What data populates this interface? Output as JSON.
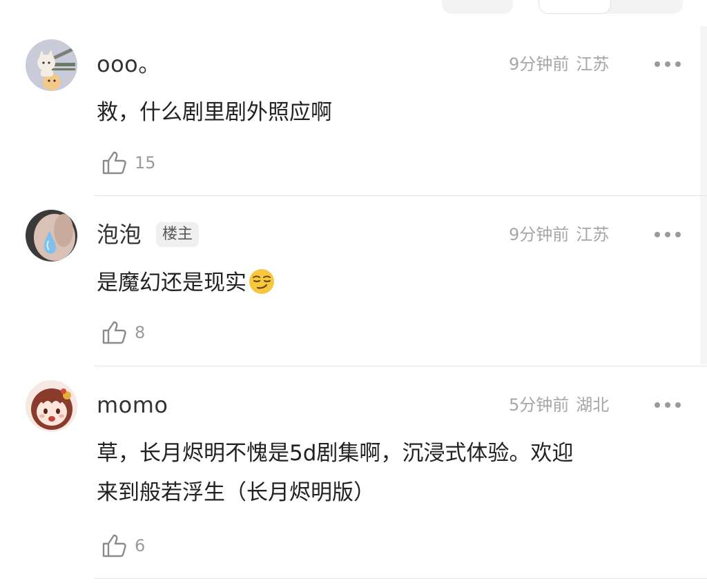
{
  "comments": [
    {
      "username": "ooo。",
      "badge": "",
      "time": "9分钟前",
      "location": "江苏",
      "text": "救，什么剧里剧外照应啊",
      "likes": "15",
      "avatar_icon": "cartoon-cat-avatar"
    },
    {
      "username": "泡泡",
      "badge": "楼主",
      "time": "9分钟前",
      "location": "江苏",
      "text": "是魔幻还是现实",
      "likes": "8",
      "avatar_icon": "hand-water-drop-avatar",
      "emoji": "smirk-emoji"
    },
    {
      "username": "momo",
      "badge": "",
      "time": "5分钟前",
      "location": "湖北",
      "text_line1": "草，长月烬明不愧是5d剧集啊，沉浸式体验。欢迎",
      "text_line2": "来到般若浮生（长月烬明版）",
      "likes": "6",
      "avatar_icon": "anime-girl-avatar"
    }
  ]
}
